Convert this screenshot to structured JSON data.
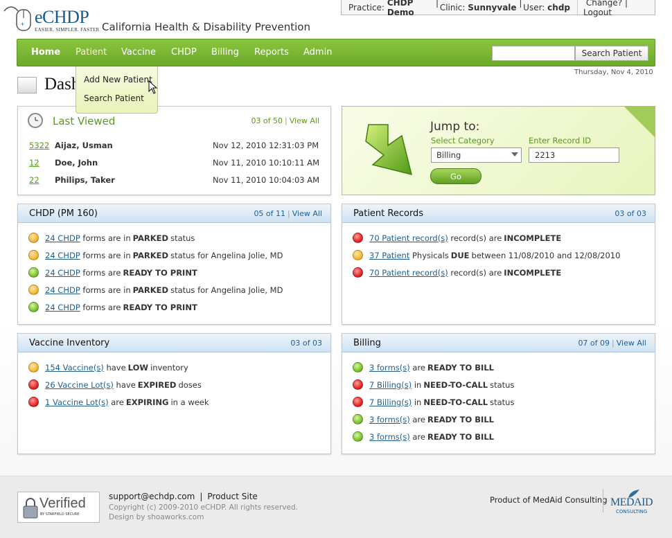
{
  "header": {
    "logo_text": "eCHDP",
    "logo_tagline": "EASIER. SIMPLER. FASTER",
    "org_name": "California Health & Disability Prevention",
    "practice_label": "Practice:",
    "practice_value": "CHDP Demo",
    "clinic_label": "Clinic:",
    "clinic_value": "Sunnyvale",
    "user_label": "User:",
    "user_value": "chdp",
    "change_link": "Change?",
    "logout_link": "Logout",
    "date": "Thursday, Nov 4, 2010"
  },
  "nav": {
    "items": [
      "Home",
      "Patient",
      "Vaccine",
      "CHDP",
      "Billing",
      "Reports",
      "Admin"
    ],
    "search_button": "Search Patient",
    "search_value": ""
  },
  "dropdown": {
    "items": [
      "Add New Patient",
      "Search Patient"
    ]
  },
  "page": {
    "title": "Dashboard"
  },
  "last_viewed": {
    "title": "Last Viewed",
    "count": "03 of 50",
    "view_all": "View All",
    "rows": [
      {
        "id": "5322",
        "name": "Aijaz, Usman",
        "date": "Nov 12, 2010 12:31:03 PM"
      },
      {
        "id": "12",
        "name": "Doe, John",
        "date": "Nov 11, 2010 10:10:11 AM"
      },
      {
        "id": "22",
        "name": "Philips, Taker",
        "date": "Nov 11, 2010 10:04:03 AM"
      }
    ]
  },
  "jump": {
    "title": "Jump to:",
    "category_label": "Select Category",
    "category_value": "Billing",
    "record_label": "Enter Record ID",
    "record_value": "2213",
    "go_button": "Go"
  },
  "chdp_panel": {
    "title": "CHDP (PM 160)",
    "count": "05 of 11",
    "view_all": "View All",
    "rows": [
      {
        "status": "orange",
        "link": "24 CHDP",
        "text1": "forms are in",
        "bold": "PARKED",
        "text2": "status"
      },
      {
        "status": "orange",
        "link": "24 CHDP",
        "text1": "forms are in",
        "bold": "PARKED",
        "text2": "status for Angelina Jolie, MD"
      },
      {
        "status": "green",
        "link": "24 CHDP",
        "text1": "forms are",
        "bold": "READY TO PRINT",
        "text2": ""
      },
      {
        "status": "orange",
        "link": "24 CHDP",
        "text1": "forms are in",
        "bold": "PARKED",
        "text2": "status for Angelina Jolie, MD"
      },
      {
        "status": "green",
        "link": "24 CHDP",
        "text1": "forms are",
        "bold": "READY TO PRINT",
        "text2": ""
      }
    ]
  },
  "patient_records": {
    "title": "Patient Records",
    "count": "03 of 03",
    "rows": [
      {
        "status": "red",
        "link": "70 Patient record(s)",
        "text1": "record(s) are",
        "bold": "INCOMPLETE",
        "text2": ""
      },
      {
        "status": "orange",
        "link": "37 Patient",
        "text1": "Physicals",
        "bold": "DUE",
        "text2": "between 11/08/2010 and 12/08/2010"
      },
      {
        "status": "red",
        "link": "70 Patient record(s)",
        "text1": "record(s) are",
        "bold": "INCOMPLETE",
        "text2": ""
      }
    ]
  },
  "vaccine_inventory": {
    "title": "Vaccine Inventory",
    "count": "03 of 03",
    "rows": [
      {
        "status": "orange",
        "link": "154 Vaccine(s)",
        "text1": "have",
        "bold": "LOW",
        "text2": "inventory"
      },
      {
        "status": "red",
        "link": "26 Vaccine Lot(s)",
        "text1": "have",
        "bold": "EXPIRED",
        "text2": "doses"
      },
      {
        "status": "red",
        "link": "1 Vaccine Lot(s)",
        "text1": "are",
        "bold": "EXPIRING",
        "text2": "in a week"
      }
    ]
  },
  "billing_panel": {
    "title": "Billing",
    "count": "07 of 09",
    "view_all": "View All",
    "rows": [
      {
        "status": "green",
        "link": "3 forms(s)",
        "text1": "are",
        "bold": "READY TO BILL",
        "text2": ""
      },
      {
        "status": "red",
        "link": "7 Billing(s)",
        "text1": "in",
        "bold": "NEED-TO-CALL",
        "text2": "status"
      },
      {
        "status": "red",
        "link": "7 Billing(s)",
        "text1": "in",
        "bold": "NEED-TO-CALL",
        "text2": "status"
      },
      {
        "status": "green",
        "link": "3 forms(s)",
        "text1": "are",
        "bold": "READY TO BILL",
        "text2": ""
      },
      {
        "status": "green",
        "link": "3 forms(s)",
        "text1": "are",
        "bold": "READY TO BILL",
        "text2": ""
      }
    ]
  },
  "footer": {
    "verified_text": "Verified",
    "verified_sub": "BY STARFIELD SECURE",
    "support_email": "support@echdp.com",
    "product_site": "Product Site",
    "copyright": "Copyright (c) 2009-2010 eCHDP. All rights reserved.",
    "design": "Design by shoaworks.com",
    "product_of": "Product of MedAid Consulting",
    "medaid_logo": "MEDAID",
    "medaid_sub": "CONSULTING"
  },
  "colors": {
    "nav_green": "#7ab833",
    "link_blue": "#1d5f93",
    "accent_green": "#5a9a1f",
    "panel_head_blue": "#cfe2f3"
  }
}
